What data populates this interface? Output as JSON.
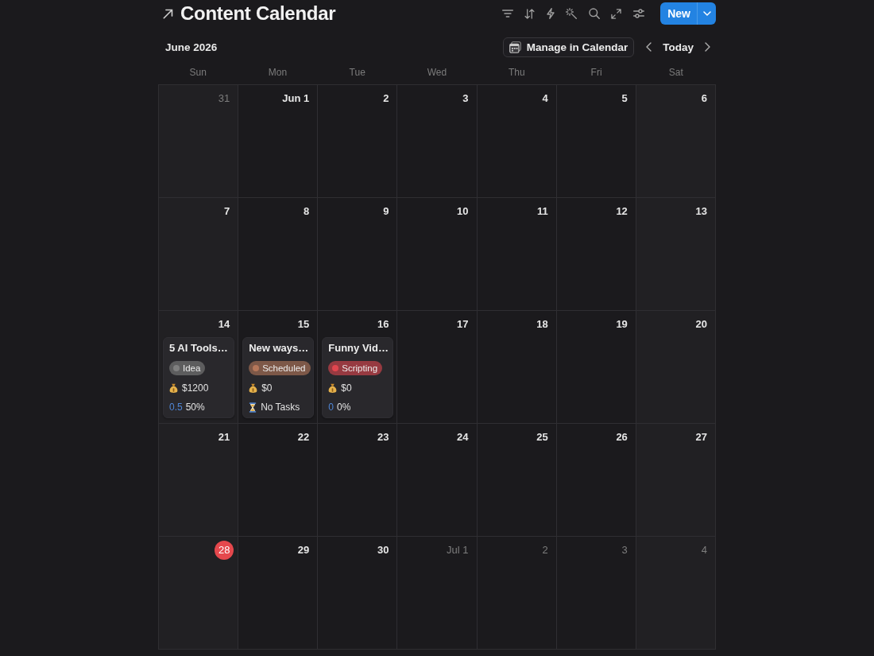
{
  "title": "Content Calendar",
  "new_button": "New",
  "month": "June 2026",
  "manage_button": "Manage in Calendar",
  "today_button": "Today",
  "weekdays": [
    "Sun",
    "Mon",
    "Tue",
    "Wed",
    "Thu",
    "Fri",
    "Sat"
  ],
  "weeks": [
    {
      "days": [
        {
          "label": "31",
          "in_month": false,
          "today": false
        },
        {
          "label": "Jun 1",
          "in_month": true,
          "today": false
        },
        {
          "label": "2",
          "in_month": true,
          "today": false
        },
        {
          "label": "3",
          "in_month": true,
          "today": false
        },
        {
          "label": "4",
          "in_month": true,
          "today": false
        },
        {
          "label": "5",
          "in_month": true,
          "today": false
        },
        {
          "label": "6",
          "in_month": true,
          "today": false
        }
      ]
    },
    {
      "days": [
        {
          "label": "7",
          "in_month": true,
          "today": false
        },
        {
          "label": "8",
          "in_month": true,
          "today": false
        },
        {
          "label": "9",
          "in_month": true,
          "today": false
        },
        {
          "label": "10",
          "in_month": true,
          "today": false
        },
        {
          "label": "11",
          "in_month": true,
          "today": false
        },
        {
          "label": "12",
          "in_month": true,
          "today": false
        },
        {
          "label": "13",
          "in_month": true,
          "today": false
        }
      ]
    },
    {
      "days": [
        {
          "label": "14",
          "in_month": true,
          "today": false,
          "events": [
            {
              "title": "5 AI Tools…",
              "status": {
                "label": "Idea",
                "color": "#7f7f7f"
              },
              "properties": [
                {
                  "kind": "money",
                  "text": "$1200"
                },
                {
                  "kind": "progress",
                  "value": "0.5",
                  "percent": "50%"
                }
              ]
            }
          ]
        },
        {
          "label": "15",
          "in_month": true,
          "today": false,
          "events": [
            {
              "title": "New ways…",
              "status": {
                "label": "Scheduled",
                "color": "#b5775a"
              },
              "properties": [
                {
                  "kind": "money",
                  "text": "$0"
                },
                {
                  "kind": "tasks",
                  "text": "No Tasks"
                }
              ]
            }
          ]
        },
        {
          "label": "16",
          "in_month": true,
          "today": false,
          "events": [
            {
              "title": "Funny Vid…",
              "status": {
                "label": "Scripting",
                "color": "#e0464f"
              },
              "properties": [
                {
                  "kind": "money",
                  "text": "$0"
                },
                {
                  "kind": "progress",
                  "value": "0",
                  "percent": "0%"
                }
              ]
            }
          ]
        },
        {
          "label": "17",
          "in_month": true,
          "today": false
        },
        {
          "label": "18",
          "in_month": true,
          "today": false
        },
        {
          "label": "19",
          "in_month": true,
          "today": false
        },
        {
          "label": "20",
          "in_month": true,
          "today": false
        }
      ]
    },
    {
      "days": [
        {
          "label": "21",
          "in_month": true,
          "today": false
        },
        {
          "label": "22",
          "in_month": true,
          "today": false
        },
        {
          "label": "23",
          "in_month": true,
          "today": false
        },
        {
          "label": "24",
          "in_month": true,
          "today": false
        },
        {
          "label": "25",
          "in_month": true,
          "today": false
        },
        {
          "label": "26",
          "in_month": true,
          "today": false
        },
        {
          "label": "27",
          "in_month": true,
          "today": false
        }
      ]
    },
    {
      "days": [
        {
          "label": "28",
          "in_month": true,
          "today": true
        },
        {
          "label": "29",
          "in_month": true,
          "today": false
        },
        {
          "label": "30",
          "in_month": true,
          "today": false
        },
        {
          "label": "Jul 1",
          "in_month": false,
          "today": false
        },
        {
          "label": "2",
          "in_month": false,
          "today": false
        },
        {
          "label": "3",
          "in_month": false,
          "today": false
        },
        {
          "label": "4",
          "in_month": false,
          "today": false
        }
      ]
    }
  ]
}
